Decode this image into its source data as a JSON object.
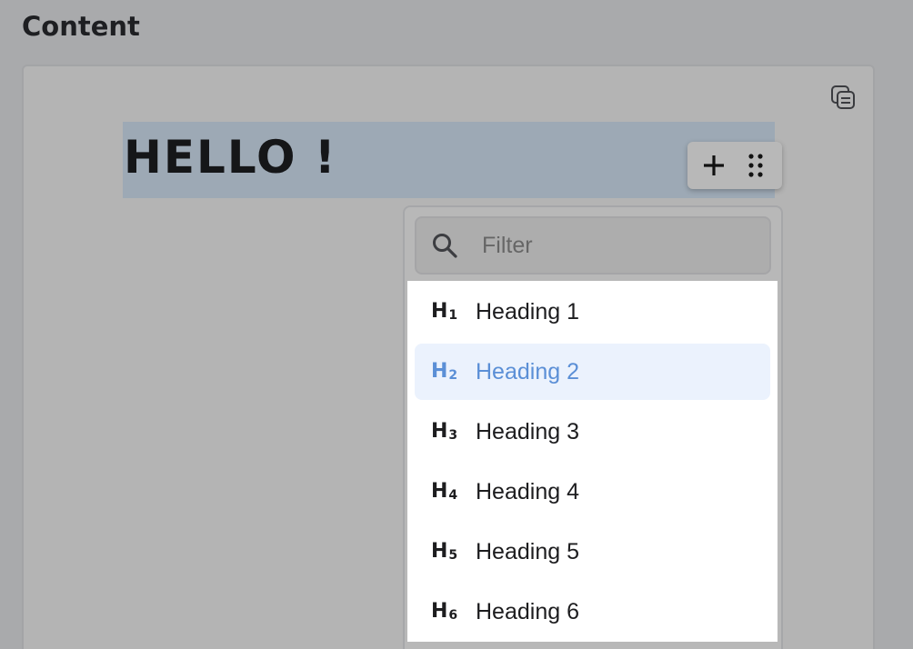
{
  "section": {
    "title": "Content"
  },
  "editor": {
    "heading_text": "HELLO !"
  },
  "icons": {
    "copy": "copy-icon",
    "add": "plus-icon",
    "drag": "drag-handle-icon",
    "search": "search-icon"
  },
  "filter": {
    "placeholder": "Filter",
    "value": ""
  },
  "menu": {
    "items": [
      {
        "icon": "H",
        "sub": "1",
        "label": "Heading 1",
        "active": false
      },
      {
        "icon": "H",
        "sub": "2",
        "label": "Heading 2",
        "active": true
      },
      {
        "icon": "H",
        "sub": "3",
        "label": "Heading 3",
        "active": false
      },
      {
        "icon": "H",
        "sub": "4",
        "label": "Heading 4",
        "active": false
      },
      {
        "icon": "H",
        "sub": "5",
        "label": "Heading 5",
        "active": false
      },
      {
        "icon": "H",
        "sub": "6",
        "label": "Heading 6",
        "active": false
      }
    ]
  },
  "colors": {
    "accent": "#5b8fd6",
    "active_bg": "#ebf2fd",
    "selection": "#9da9b5"
  }
}
